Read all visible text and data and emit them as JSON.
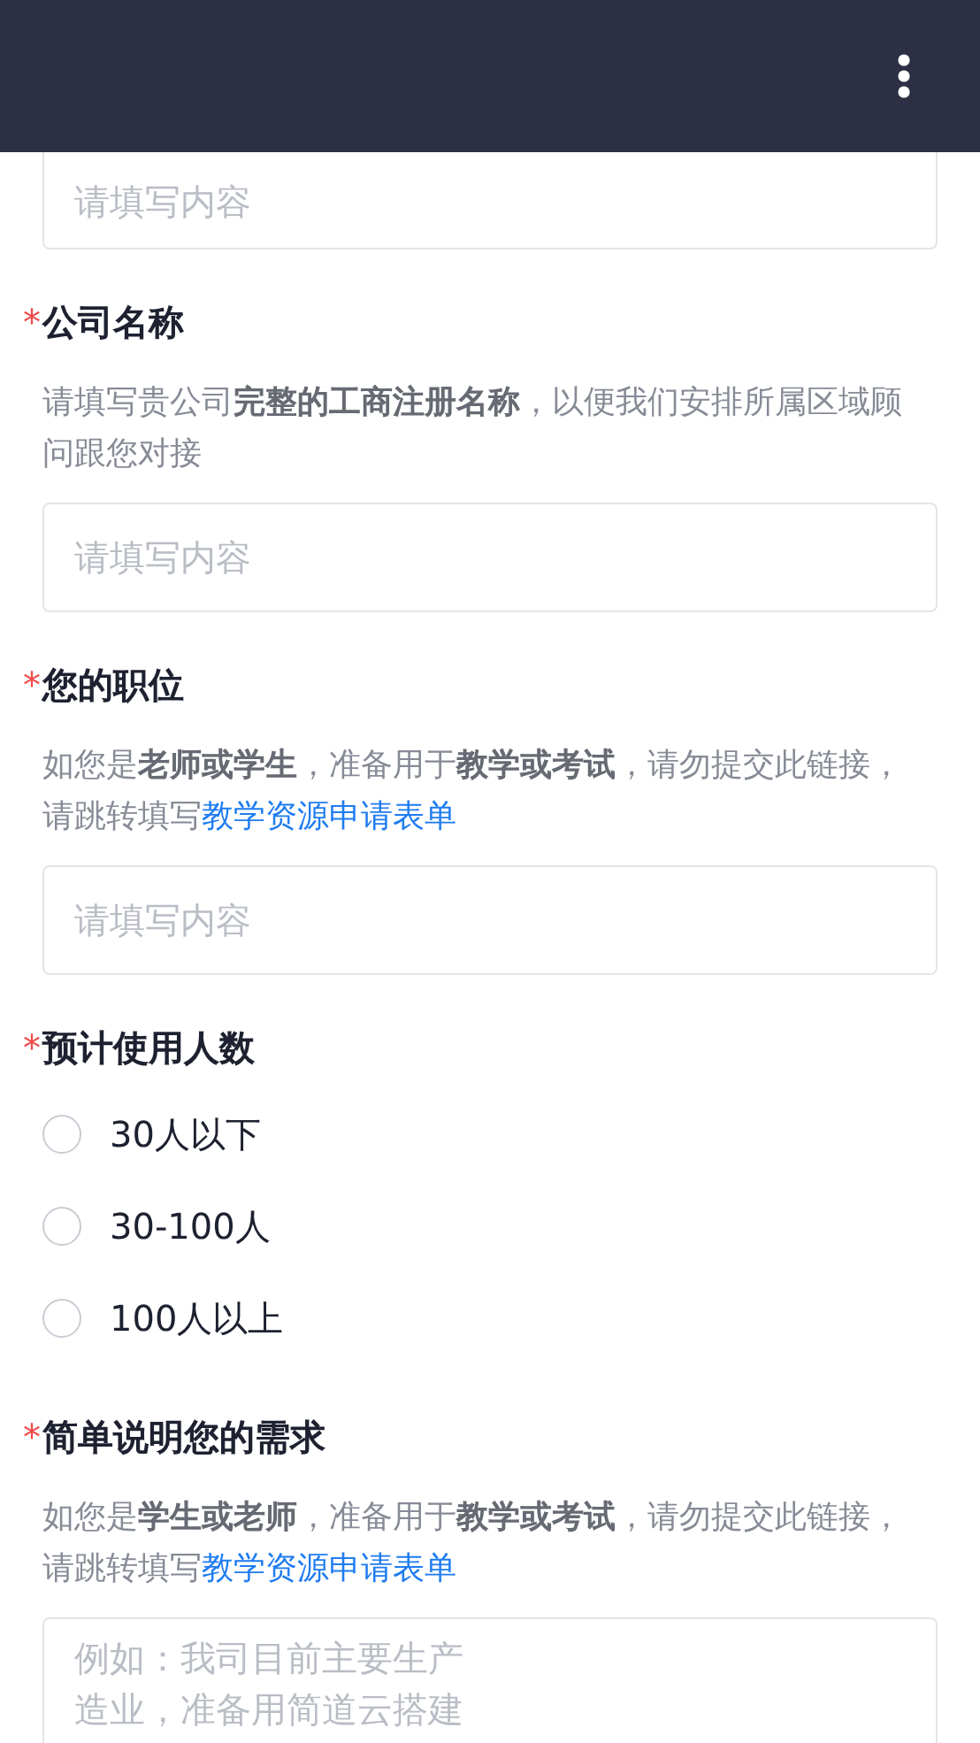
{
  "top_field": {
    "placeholder": "请填写内容"
  },
  "fields": [
    {
      "kind": "text",
      "label": "公司名称",
      "required_mark": "*",
      "hint": "请填写贵公司**完整的工商注册名称**，以便我们安排所属区域顾问跟您对接",
      "placeholder": "请填写内容"
    },
    {
      "kind": "text",
      "label": "您的职位",
      "required_mark": "*",
      "hint": "如您是**老师或学生**，准备用于**教学或考试**，请勿提交此链接，请跳转填写",
      "link": "教学资源申请表单",
      "placeholder": "请填写内容"
    },
    {
      "kind": "radio",
      "label": "预计使用人数",
      "required_mark": "*",
      "options": [
        {
          "label": "30人以下",
          "selected": false
        },
        {
          "label": "30-100人",
          "selected": false
        },
        {
          "label": "100人以上",
          "selected": false
        }
      ]
    },
    {
      "kind": "textarea",
      "label": "简单说明您的需求",
      "required_mark": "*",
      "hint": "如您是**学生或老师**，准备用于**教学或考试**，请勿提交此链接，请跳转填写",
      "link": "教学资源申请表单",
      "placeholder_lines": [
        "例如：我司目前主要生产",
        "造业，准备用简道云搭建"
      ]
    }
  ]
}
